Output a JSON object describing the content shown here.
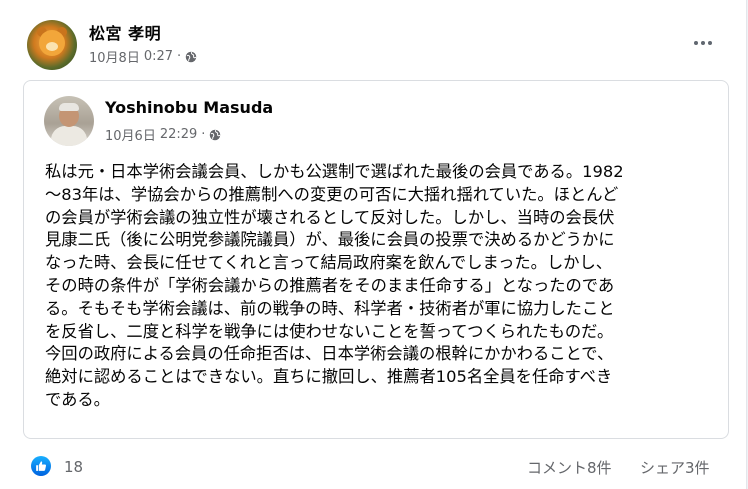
{
  "post": {
    "author": "松宮 孝明",
    "date": "10月8日",
    "time": "0:27",
    "separator": "·",
    "privacy_icon": "globe-icon",
    "more_icon": "more-horizontal-icon"
  },
  "shared_post": {
    "author": "Yoshinobu Masuda",
    "date": "10月6日",
    "time": "22:29",
    "separator": "·",
    "privacy_icon": "globe-icon",
    "text_lines": [
      "私は元・日本学術会議会員、しかも公選制で選ばれた最後の会員である。1982",
      "～83年は、学協会からの推薦制への変更の可否に大揺れ揺れていた。ほとんど",
      "の会員が学術会議の独立性が壊されるとして反対した。しかし、当時の会長伏",
      "見康二氏（後に公明党参議院議員）が、最後に会員の投票で決めるかどうかに",
      "なった時、会長に任せてくれと言って結局政府案を飲んでしまった。しかし、",
      "その時の条件が「学術会議からの推薦者をそのまま任命する」となったのであ",
      "る。そもそも学術会議は、前の戦争の時、科学者・技術者が軍に協力したこと",
      "を反省し、二度と科学を戦争には使わせないことを誓ってつくられたものだ。",
      "今回の政府による会員の任命拒否は、日本学術会議の根幹にかかわることで、",
      "絶対に認めることはできない。直ちに撤回し、推薦者105名全員を任命すべき",
      "である。"
    ]
  },
  "footer": {
    "reaction_icon": "like-icon",
    "reaction_count": "18",
    "comments": "コメント8件",
    "shares": "シェア3件"
  },
  "colors": {
    "secondary_text": "#65676b",
    "like_blue": "#1877f2",
    "border": "#dadde1"
  }
}
